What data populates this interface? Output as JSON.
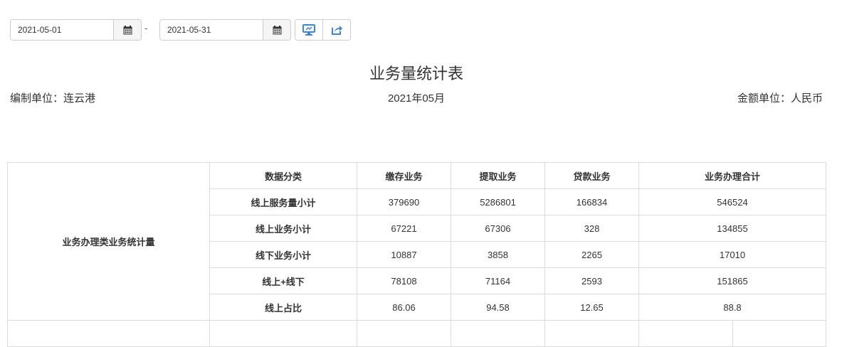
{
  "filters": {
    "start_date": "2021-05-01",
    "end_date": "2021-05-31",
    "separator": "-"
  },
  "icons": {
    "calendar": "calendar-icon",
    "display": "monitor-icon",
    "export": "share-export-icon",
    "accent": "#3a87d9"
  },
  "report": {
    "title": "业务量统计表",
    "unit_left": "编制单位：连云港",
    "period": "2021年05月",
    "unit_right": "金额单位：人民币"
  },
  "table": {
    "group_label": "业务办理类业务统计量",
    "headers": [
      "数据分类",
      "缴存业务",
      "提取业务",
      "贷款业务",
      "业务办理合计"
    ],
    "rows": [
      {
        "category": "线上服务量小计",
        "values": [
          "379690",
          "5286801",
          "166834",
          "546524"
        ]
      },
      {
        "category": "线上业务小计",
        "values": [
          "67221",
          "67306",
          "328",
          "134855"
        ]
      },
      {
        "category": "线下业务小计",
        "values": [
          "10887",
          "3858",
          "2265",
          "17010"
        ]
      },
      {
        "category": "线上+线下",
        "values": [
          "78108",
          "71164",
          "2593",
          "151865"
        ]
      },
      {
        "category": "线上占比",
        "values": [
          "86.06",
          "94.58",
          "12.65",
          "88.8"
        ]
      }
    ]
  }
}
